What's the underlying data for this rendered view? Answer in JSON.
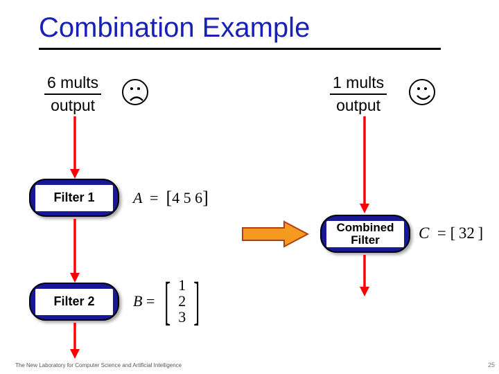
{
  "title": "Combination Example",
  "left": {
    "mults": "6 mults",
    "output": "output"
  },
  "right": {
    "mults": "1 mults",
    "output": "output"
  },
  "filter1": {
    "label": "Filter 1",
    "matrix_name": "A",
    "matrix_values": "4   5   6"
  },
  "filter2": {
    "label": "Filter 2",
    "matrix_name": "B",
    "matrix_values": [
      "1",
      "2",
      "3"
    ]
  },
  "combined": {
    "label_line1": "Combined",
    "label_line2": "Filter",
    "c_name": "C",
    "c_value": "32"
  },
  "equals": "=",
  "lbr": "[",
  "rbr": "]",
  "footer": "The New Laboratory for Computer Science and Artificial Intelligence",
  "pagenum": "25"
}
